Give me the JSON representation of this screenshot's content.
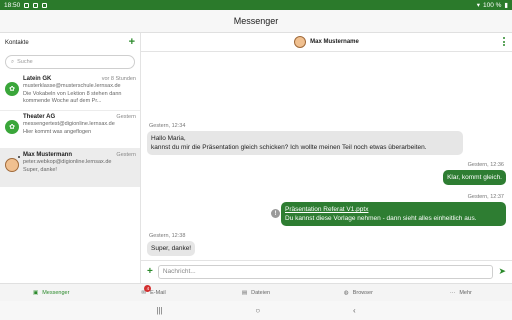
{
  "status": {
    "time": "18:50",
    "battery": "100 %"
  },
  "app": {
    "title": "Messenger"
  },
  "sidebar": {
    "title": "Kontakte",
    "add_label": "+",
    "search_placeholder": "Suche",
    "contacts": [
      {
        "name": "Latein GK",
        "time": "vor 8 Stunden",
        "sub": "musterklasse@musterschule.lernsax.de",
        "preview": "Die Vokabeln von Lektion 8 stehen dann kommende Woche auf dem Pr..."
      },
      {
        "name": "Theater AG",
        "time": "Gestern",
        "sub": "messengertest@digionline.lernsax.de",
        "preview": "Hier kommt was angeflogen"
      },
      {
        "name": "Max Mustermann",
        "time": "Gestern",
        "sub": "peter.webkop@digionline.lernsax.de",
        "preview": "Super, danke!"
      }
    ]
  },
  "chat": {
    "contact_name": "Max Mustername",
    "messages": [
      {
        "time": "Gestern, 12:34",
        "text1": "Hallo Maria,",
        "text2": "kannst du mir die Präsentation gleich schicken? Ich wollte meinen Teil noch etwas überarbeiten."
      },
      {
        "time": "Gestern, 12:36",
        "text": "Klar, kommt gleich."
      },
      {
        "time": "Gestern, 12:37",
        "link": "Präsentation Referat V1.pptx",
        "text": "Du kannst diese Vorlage nehmen - dann sieht alles einheitlich aus."
      },
      {
        "time": "Gestern, 12:38",
        "text": "Super, danke!"
      }
    ],
    "input_placeholder": "Nachricht..."
  },
  "tabs": [
    {
      "label": "Messenger"
    },
    {
      "label": "E-Mail",
      "badge": "4"
    },
    {
      "label": "Dateien"
    },
    {
      "label": "Browser"
    },
    {
      "label": "Mehr"
    }
  ]
}
